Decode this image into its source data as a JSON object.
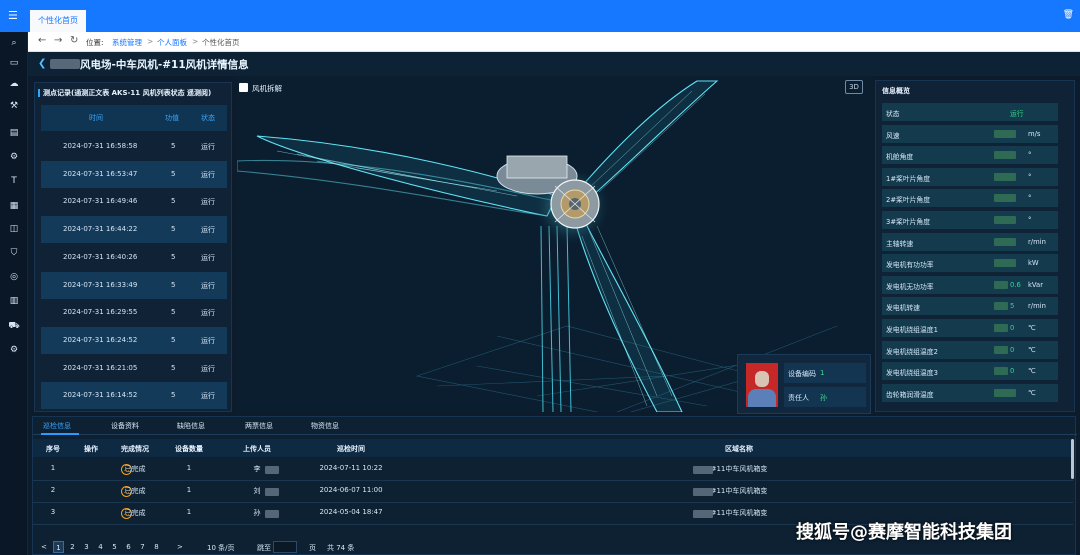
{
  "topbar": {
    "tab_label": "个性化首页"
  },
  "navbar": {
    "location_label": "位置:",
    "crumbs": [
      "系统管理",
      "个人面板",
      "个性化首页"
    ]
  },
  "page": {
    "title": "风电场-中车风机-#11风机详情信息"
  },
  "records": {
    "title": "测点记录(通测正文表 AKS-11 风机列表状态 遥测阅)",
    "columns": [
      "时间",
      "功值",
      "状态"
    ],
    "rows": [
      [
        "2024-07-31 16:58:58",
        "5",
        "运行"
      ],
      [
        "2024-07-31 16:53:47",
        "5",
        "运行"
      ],
      [
        "2024-07-31 16:49:46",
        "5",
        "运行"
      ],
      [
        "2024-07-31 16:44:22",
        "5",
        "运行"
      ],
      [
        "2024-07-31 16:40:26",
        "5",
        "运行"
      ],
      [
        "2024-07-31 16:33:49",
        "5",
        "运行"
      ],
      [
        "2024-07-31 16:29:55",
        "5",
        "运行"
      ],
      [
        "2024-07-31 16:24:52",
        "5",
        "运行"
      ],
      [
        "2024-07-31 16:21:05",
        "5",
        "运行"
      ],
      [
        "2024-07-31 16:14:52",
        "5",
        "运行"
      ]
    ]
  },
  "viewer": {
    "explode_label": "风机拆解",
    "mode_label": "3D"
  },
  "device_card": {
    "code_label": "设备编码",
    "code_value": "1",
    "owner_label": "责任人",
    "owner_value": "孙"
  },
  "info": {
    "title": "信息概览",
    "rows": [
      {
        "label": "状态",
        "value": "运行",
        "unit": ""
      },
      {
        "label": "风速",
        "value": "",
        "unit": "m/s"
      },
      {
        "label": "机舱角度",
        "value": "",
        "unit": "°"
      },
      {
        "label": "1#桨叶片角度",
        "value": "",
        "unit": "°"
      },
      {
        "label": "2#桨叶片角度",
        "value": "",
        "unit": "°"
      },
      {
        "label": "3#桨叶片角度",
        "value": "",
        "unit": "°"
      },
      {
        "label": "主轴转速",
        "value": "",
        "unit": "r/min"
      },
      {
        "label": "发电机有功功率",
        "value": "",
        "unit": "kW"
      },
      {
        "label": "发电机无功功率",
        "value": "0.6",
        "unit": "kVar"
      },
      {
        "label": "发电机转速",
        "value": "5",
        "unit": "r/min"
      },
      {
        "label": "发电机绕组温度1",
        "value": "0",
        "unit": "℃"
      },
      {
        "label": "发电机绕组温度2",
        "value": "0",
        "unit": "℃"
      },
      {
        "label": "发电机绕组温度3",
        "value": "0",
        "unit": "℃"
      },
      {
        "label": "齿轮箱润滑温度",
        "value": "",
        "unit": "℃"
      }
    ]
  },
  "tabs": [
    "巡检信息",
    "设备资料",
    "缺陷信息",
    "两票信息",
    "物资信息"
  ],
  "table": {
    "columns": [
      "序号",
      "操作",
      "完成情况",
      "设备数量",
      "上传人员",
      "巡检时间",
      "区域名称"
    ],
    "rows": [
      [
        "1",
        "...",
        "已完成",
        "1",
        "李",
        "2024-07-11 10:22",
        "#11中车风机箱变"
      ],
      [
        "2",
        "...",
        "已完成",
        "1",
        "刘",
        "2024-06-07 11:00",
        "#11中车风机箱变"
      ],
      [
        "3",
        "...",
        "已完成",
        "1",
        "孙",
        "2024-05-04 18:47",
        "#11中车风机箱变"
      ]
    ]
  },
  "pager": {
    "prev": "<",
    "pages": [
      "1",
      "2",
      "3",
      "4",
      "5",
      "6",
      "7",
      "8"
    ],
    "next": ">",
    "page_size": "10 条/页",
    "jump_label": "跳至",
    "page_unit": "页",
    "total": "共 74 条"
  },
  "watermark": "搜狐号@赛摩智能科技集团"
}
